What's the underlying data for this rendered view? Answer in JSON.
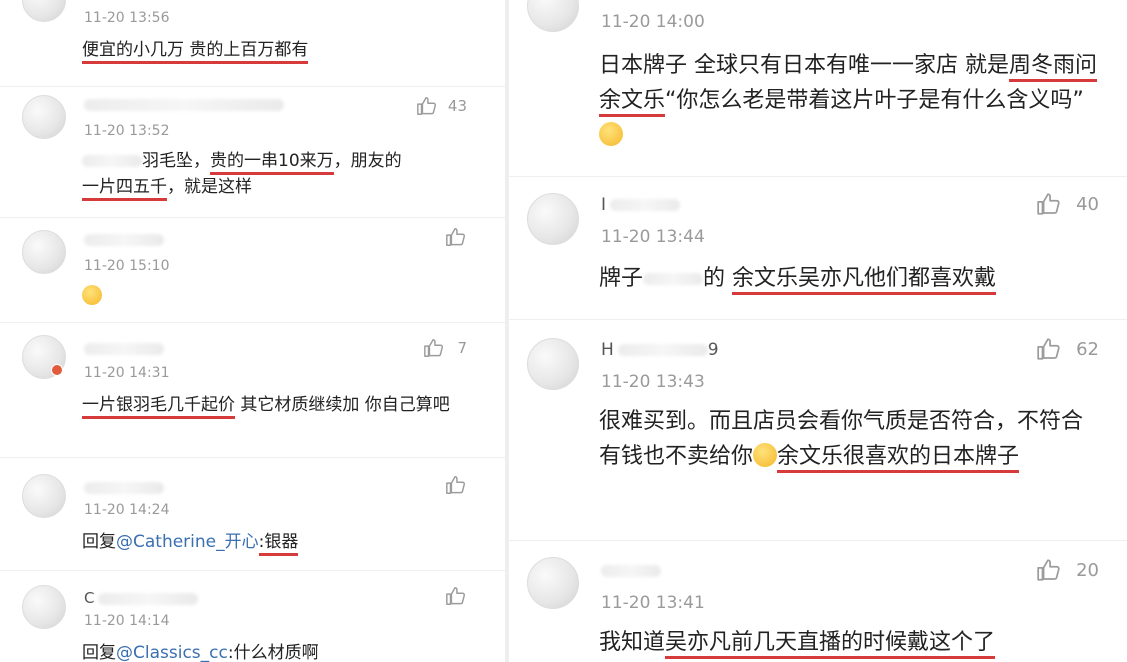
{
  "left": {
    "comments": [
      {
        "time": "11-20 13:56",
        "text": "便宜的小几万 贵的上百万都有",
        "likes": ""
      },
      {
        "time": "11-20 13:52",
        "text_a": "羽毛坠，",
        "text_b": "贵的一串10来万",
        "text_c": "，朋友的",
        "text_d": "一片四五千",
        "text_e": "，就是这样",
        "likes": "43"
      },
      {
        "time": "11-20 15:10",
        "emoji": "😵",
        "likes": ""
      },
      {
        "time": "11-20 14:31",
        "text_a": "一片银羽毛几千起价",
        "text_b": " 其它材质继续加 你自己算吧",
        "likes": "7"
      },
      {
        "time": "11-20 14:24",
        "reply_prefix": "回复",
        "mention": "@Catherine_开心",
        "colon": ":",
        "reply_text": "银器",
        "likes": ""
      },
      {
        "username": "C",
        "time": "11-20 14:14",
        "reply_prefix": "回复",
        "mention": "@Classics_cc",
        "reply_text": ":什么材质啊",
        "likes": ""
      }
    ]
  },
  "right": {
    "comments": [
      {
        "time": "11-20 14:00",
        "text_a": "日本牌子 全球只有日本有唯一一家店 就是",
        "text_b": "周冬雨问余文乐",
        "text_c": "“你怎么老是带着这片叶子是有什么含义吗”",
        "emoji": "😂",
        "likes": ""
      },
      {
        "username": "I",
        "time": "11-20 13:44",
        "text_a": "牌子",
        "text_b": "的 ",
        "text_c": "余文乐吴亦凡他们都喜欢戴",
        "likes": "40"
      },
      {
        "username": "H",
        "username_tail": "9",
        "time": "11-20 13:43",
        "text_a": "很难买到。而且店员会看你气质是否符合，不符合有钱也不卖给你",
        "emoji": "🤗",
        "text_b": "余文乐很喜欢的日本牌子",
        "likes": "62"
      },
      {
        "time": "11-20 13:41",
        "text_a": "我知道",
        "text_b": "吴亦凡前几天直播的时候戴这个了",
        "likes": "20"
      }
    ]
  },
  "icons": {
    "like": "thumbs-up-icon"
  }
}
